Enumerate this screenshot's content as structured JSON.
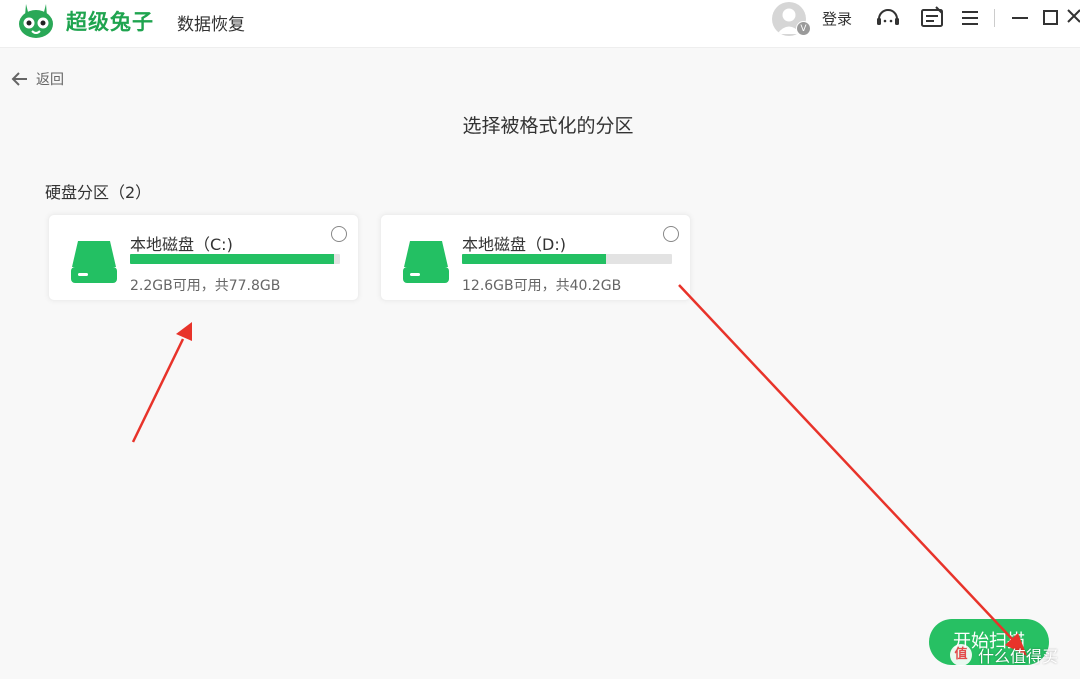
{
  "header": {
    "brand": "超级兔子",
    "product": "数据恢复",
    "avatar_badge": "V",
    "login_label": "登录",
    "icons": [
      "rabbit-logo-icon",
      "user-avatar-icon",
      "customer-service-icon",
      "feedback-icon",
      "menu-icon",
      "minimize-icon",
      "maximize-icon",
      "close-icon"
    ]
  },
  "nav": {
    "back_label": "返回"
  },
  "main": {
    "page_title": "选择被格式化的分区",
    "section_title": "硬盘分区（2）",
    "partitions": [
      {
        "name": "本地磁盘（C:)",
        "info": "2.2GB可用，共77.8GB",
        "used_fraction": 0.972
      },
      {
        "name": "本地磁盘（D:)",
        "info": "12.6GB可用，共40.2GB",
        "used_fraction": 0.687
      }
    ],
    "start_label": "开始扫描"
  },
  "watermark": {
    "badge": "值",
    "text": "什么值得买"
  },
  "colors": {
    "brand_green": "#1fa44f",
    "progress_green": "#23c063",
    "button_green": "#27c063",
    "annotation_red": "#e8332a"
  }
}
